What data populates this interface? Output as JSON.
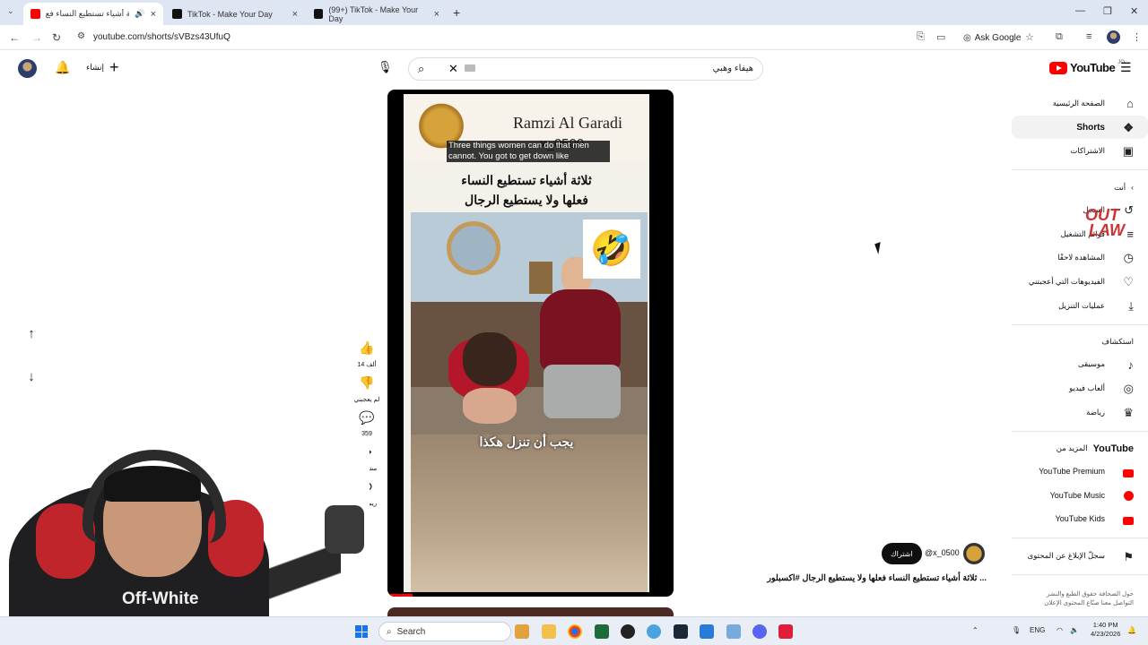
{
  "browser": {
    "tabs": [
      {
        "title": "ثلاثة أشياء تستطيع النساء فع",
        "active": true
      },
      {
        "title": "TikTok - Make Your Day",
        "active": false
      },
      {
        "title": "(99+) TikTok - Make Your Day",
        "active": false
      }
    ],
    "url": "youtube.com/shorts/sVBzs43UfuQ",
    "ask_google": "Ask Google"
  },
  "header": {
    "create_label": "إنشاء",
    "search_query": "هيفاء وهبي",
    "logo_text": "YouTube",
    "logo_country": "JO"
  },
  "sidebar": {
    "main": [
      {
        "label": "الصفحة الرئيسية",
        "icon": "home-icon",
        "glyph": "⌂"
      },
      {
        "label": "Shorts",
        "icon": "shorts-icon",
        "glyph": "❖",
        "active": true
      },
      {
        "label": "الاشتراكات",
        "icon": "subscriptions-icon",
        "glyph": "▣"
      }
    ],
    "you_header": "أنت",
    "you": [
      {
        "label": "السجل",
        "icon": "history-icon",
        "glyph": "↺"
      },
      {
        "label": "قوائم التشغيل",
        "icon": "playlists-icon",
        "glyph": "≡"
      },
      {
        "label": "المشاهدة لاحقًا",
        "icon": "watch-later-icon",
        "glyph": "◷"
      },
      {
        "label": "الفيديوهات التي أعجبتني",
        "icon": "liked-icon",
        "glyph": "👍"
      },
      {
        "label": "عمليات التنزيل",
        "icon": "download-icon",
        "glyph": "⤓"
      }
    ],
    "explore_header": "استكشاف",
    "explore": [
      {
        "label": "موسيقى",
        "icon": "music-icon",
        "glyph": "♪"
      },
      {
        "label": "ألعاب فيديو",
        "icon": "gaming-icon",
        "glyph": "◎"
      },
      {
        "label": "رياضة",
        "icon": "trophy-icon",
        "glyph": "🏆"
      }
    ],
    "more_header": "المزيد من",
    "more_brand": "YouTube",
    "more": [
      {
        "label": "YouTube Premium"
      },
      {
        "label": "YouTube Music"
      },
      {
        "label": "YouTube Kids"
      }
    ],
    "report": "سجلّ الإبلاغ عن المحتوى",
    "footer_1": "حول  الصحافة  حقوق الطبع والنشر",
    "footer_2": "التواصل معنا  صنّاع المحتوى  الإعلان"
  },
  "video": {
    "channel_overlay": "Ramzi Al Garadi",
    "subs_overlay": "x_0500",
    "caption": "Three things women can do that men cannot. You got to get down like",
    "arabic_title_1": "ثلاثة أشياء تستطيع النساء",
    "arabic_title_2": "فعلها ولا يستطيع الرجال",
    "subtitle": "يجب أن تنزل هكذا",
    "emoji": "🤣"
  },
  "actions": {
    "likes": "14 ألف",
    "dislike_label": "لم يعجبني",
    "comments": "359",
    "share_label": "مشاركة",
    "remix_label": "ريمكس"
  },
  "short_info": {
    "subscribe": "اشتراك",
    "handle": "@x_0500",
    "title": "ثلاثة أشياء تستطيع النساء فعلها ولا يستطيع الرجال #اكسبلور ..."
  },
  "webcam": {
    "shirt_text": "Off-White"
  },
  "watermark": {
    "line1": "OUT",
    "line2": "LAW"
  },
  "taskbar": {
    "search": "Search",
    "lang": "ENG",
    "time": "1:40 PM",
    "date": "4/23/2026"
  }
}
